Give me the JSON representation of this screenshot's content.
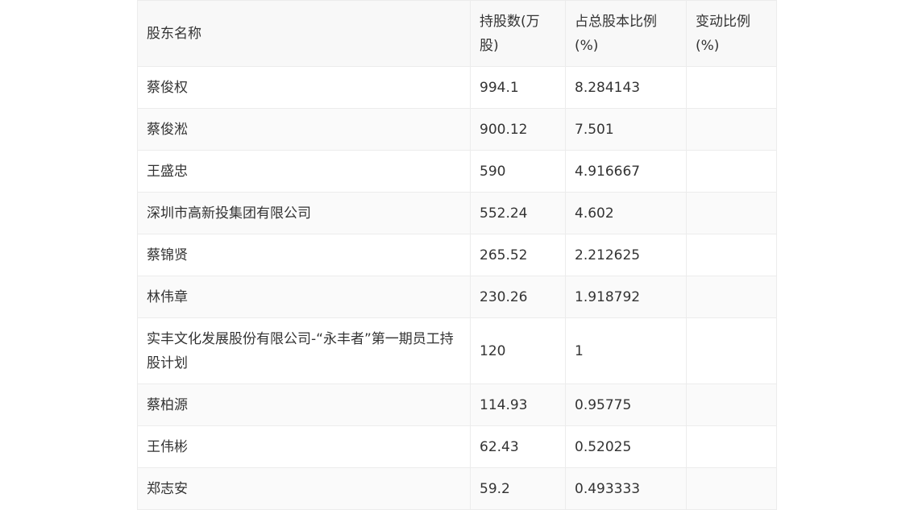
{
  "table": {
    "headers": [
      "股东名称",
      "持股数(万股)",
      "占总股本比例(%)",
      "变动比例(%)"
    ],
    "rows": [
      {
        "name": "蔡俊权",
        "shares": "994.1",
        "ratio": "8.284143",
        "change": ""
      },
      {
        "name": "蔡俊淞",
        "shares": "900.12",
        "ratio": "7.501",
        "change": ""
      },
      {
        "name": "王盛忠",
        "shares": "590",
        "ratio": "4.916667",
        "change": ""
      },
      {
        "name": "深圳市高新投集团有限公司",
        "shares": "552.24",
        "ratio": "4.602",
        "change": ""
      },
      {
        "name": "蔡锦贤",
        "shares": "265.52",
        "ratio": "2.212625",
        "change": ""
      },
      {
        "name": "林伟章",
        "shares": "230.26",
        "ratio": "1.918792",
        "change": ""
      },
      {
        "name": "实丰文化发展股份有限公司-“永丰者”第一期员工持股计划",
        "shares": "120",
        "ratio": "1",
        "change": ""
      },
      {
        "name": "蔡柏源",
        "shares": "114.93",
        "ratio": "0.95775",
        "change": ""
      },
      {
        "name": "王伟彬",
        "shares": "62.43",
        "ratio": "0.52025",
        "change": ""
      },
      {
        "name": "郑志安",
        "shares": "59.2",
        "ratio": "0.493333",
        "change": ""
      }
    ]
  }
}
